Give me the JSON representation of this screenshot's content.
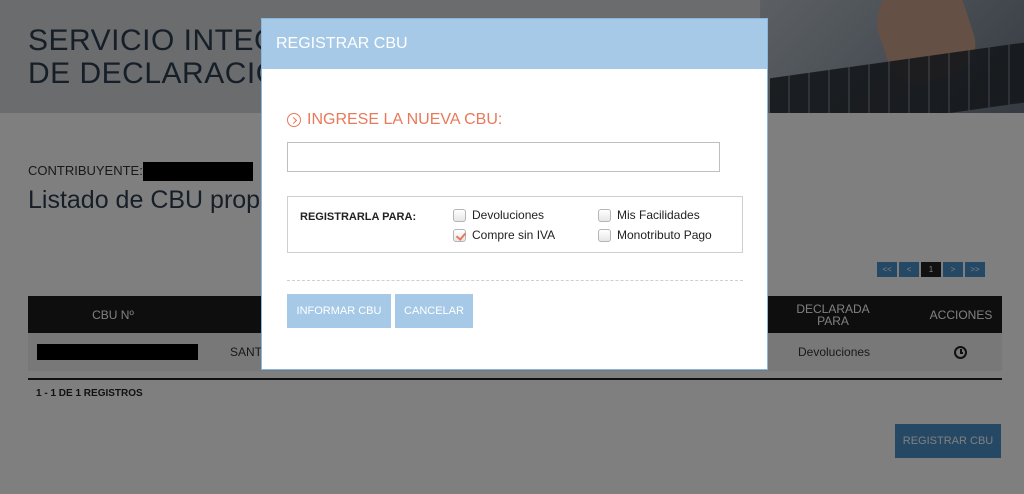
{
  "hero": {
    "title_line1": "SERVICIO INTEGRAL",
    "title_line2": "DE DECLARACIÓN"
  },
  "page": {
    "contributor_label": "CONTRIBUYENTE:",
    "list_title": "Listado de CBU propias"
  },
  "pager": {
    "first": "<<",
    "prev": "<",
    "current": "1",
    "next": ">",
    "last": ">>"
  },
  "table": {
    "headers": {
      "cbu": "CBU Nº",
      "declared_for": "DECLARADA PARA",
      "actions": "ACCIONES"
    },
    "rows": [
      {
        "bank_prefix": "SANT",
        "declared_for": "Devoluciones"
      }
    ],
    "records_summary": "1 - 1 DE 1 REGISTROS"
  },
  "register_button_label": "REGISTRAR CBU",
  "modal": {
    "title": "REGISTRAR CBU",
    "section_title": "INGRESE LA NUEVA CBU:",
    "cbu_input_value": "",
    "register_for_label": "REGISTRARLA PARA:",
    "options": [
      {
        "label": "Devoluciones",
        "checked": false
      },
      {
        "label": "Mis Facilidades",
        "checked": false
      },
      {
        "label": "Compre sin IVA",
        "checked": true
      },
      {
        "label": "Monotributo Pago",
        "checked": false
      }
    ],
    "submit_label": "INFORMAR CBU",
    "cancel_label": "CANCELAR"
  },
  "colors": {
    "modal_header": "#a6c9e8",
    "accent_orange": "#e8795a",
    "table_header": "#1d1d1d"
  }
}
